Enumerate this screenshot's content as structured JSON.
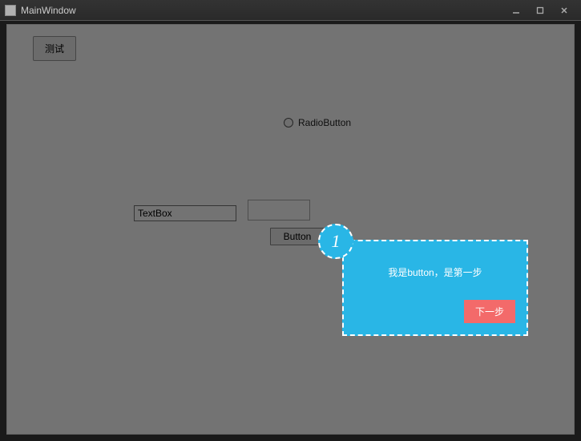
{
  "titlebar": {
    "title": "MainWindow"
  },
  "buttons": {
    "test_label": "测试",
    "center_label": "Button"
  },
  "radio": {
    "label": "RadioButton"
  },
  "inputs": {
    "textbox1_value": "TextBox",
    "textbox2_value": ""
  },
  "coach": {
    "step_number": "1",
    "message": "我是button，是第一步",
    "next_label": "下一步"
  }
}
